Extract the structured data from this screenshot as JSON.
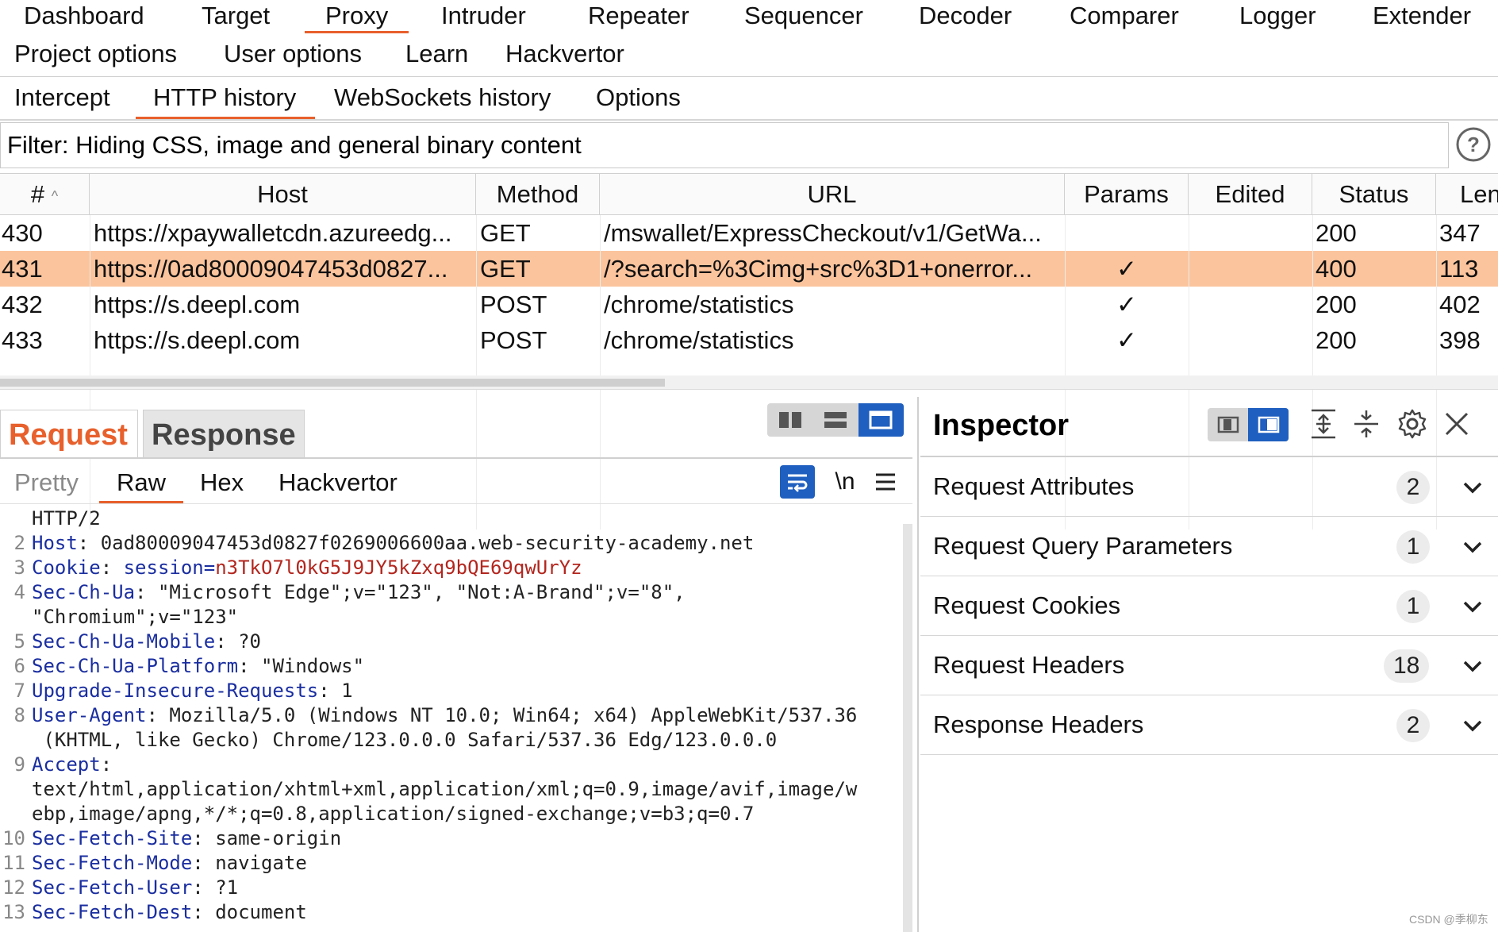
{
  "menu": {
    "row1": [
      "Dashboard",
      "Target",
      "Proxy",
      "Intruder",
      "Repeater",
      "Sequencer",
      "Decoder",
      "Comparer",
      "Logger",
      "Extender"
    ],
    "row2": [
      "Project options",
      "User options",
      "Learn",
      "Hackvertor"
    ],
    "active": "Proxy"
  },
  "subtabs": {
    "items": [
      "Intercept",
      "HTTP history",
      "WebSockets history",
      "Options"
    ],
    "active": "HTTP history"
  },
  "filter": {
    "text": "Filter: Hiding CSS, image and general binary content"
  },
  "table": {
    "columns": [
      "#",
      "Host",
      "Method",
      "URL",
      "Params",
      "Edited",
      "Status",
      "Len"
    ],
    "sort_indicator": "^",
    "rows": [
      {
        "num": "430",
        "host": "https://xpaywalletcdn.azureedg...",
        "method": "GET",
        "url": "/mswallet/ExpressCheckout/v1/GetWa...",
        "params": "",
        "edited": "",
        "status": "200",
        "len": "347",
        "selected": false
      },
      {
        "num": "431",
        "host": "https://0ad80009047453d0827...",
        "method": "GET",
        "url": "/?search=%3Cimg+src%3D1+onerror...",
        "params": "✓",
        "edited": "",
        "status": "400",
        "len": "113",
        "selected": true
      },
      {
        "num": "432",
        "host": "https://s.deepl.com",
        "method": "POST",
        "url": "/chrome/statistics",
        "params": "✓",
        "edited": "",
        "status": "200",
        "len": "402",
        "selected": false
      },
      {
        "num": "433",
        "host": "https://s.deepl.com",
        "method": "POST",
        "url": "/chrome/statistics",
        "params": "✓",
        "edited": "",
        "status": "200",
        "len": "398",
        "selected": false
      }
    ]
  },
  "message_tabs": {
    "request": "Request",
    "response": "Response",
    "active": "Request"
  },
  "view_tabs": {
    "items": [
      "Pretty",
      "Raw",
      "Hex",
      "Hackvertor"
    ],
    "active": "Raw"
  },
  "editor": {
    "newline_toggle": "\\n",
    "lines": [
      {
        "n": "",
        "key": "",
        "sep": "",
        "val": "HTTP/2"
      },
      {
        "n": "2",
        "key": "Host",
        "sep": ": ",
        "val": "0ad80009047453d0827f0269006600aa.web-security-academy.net"
      },
      {
        "n": "3",
        "key": "Cookie",
        "sep": ": ",
        "ckey": "session=",
        "cval": "n3TkO7l0kG5J9JY5kZxq9bQE69qwUrYz"
      },
      {
        "n": "4",
        "key": "Sec-Ch-Ua",
        "sep": ": ",
        "val": "\"Microsoft Edge\";v=\"123\", \"Not:A-Brand\";v=\"8\","
      },
      {
        "n": "",
        "key": "",
        "sep": "",
        "val": "\"Chromium\";v=\"123\""
      },
      {
        "n": "5",
        "key": "Sec-Ch-Ua-Mobile",
        "sep": ": ",
        "val": "?0"
      },
      {
        "n": "6",
        "key": "Sec-Ch-Ua-Platform",
        "sep": ": ",
        "val": "\"Windows\""
      },
      {
        "n": "7",
        "key": "Upgrade-Insecure-Requests",
        "sep": ": ",
        "val": "1"
      },
      {
        "n": "8",
        "key": "User-Agent",
        "sep": ": ",
        "val": "Mozilla/5.0 (Windows NT 10.0; Win64; x64) AppleWebKit/537.36"
      },
      {
        "n": "",
        "key": "",
        "sep": "",
        "val": " (KHTML, like Gecko) Chrome/123.0.0.0 Safari/537.36 Edg/123.0.0.0"
      },
      {
        "n": "9",
        "key": "Accept",
        "sep": ":",
        "val": ""
      },
      {
        "n": "",
        "key": "",
        "sep": "",
        "val": "text/html,application/xhtml+xml,application/xml;q=0.9,image/avif,image/w"
      },
      {
        "n": "",
        "key": "",
        "sep": "",
        "val": "ebp,image/apng,*/*;q=0.8,application/signed-exchange;v=b3;q=0.7"
      },
      {
        "n": "10",
        "key": "Sec-Fetch-Site",
        "sep": ": ",
        "val": "same-origin"
      },
      {
        "n": "11",
        "key": "Sec-Fetch-Mode",
        "sep": ": ",
        "val": "navigate"
      },
      {
        "n": "12",
        "key": "Sec-Fetch-User",
        "sep": ": ",
        "val": "?1"
      },
      {
        "n": "13",
        "key": "Sec-Fetch-Dest",
        "sep": ": ",
        "val": "document"
      }
    ]
  },
  "inspector": {
    "title": "Inspector",
    "sections": [
      {
        "label": "Request Attributes",
        "count": "2"
      },
      {
        "label": "Request Query Parameters",
        "count": "1"
      },
      {
        "label": "Request Cookies",
        "count": "1"
      },
      {
        "label": "Request Headers",
        "count": "18"
      },
      {
        "label": "Response Headers",
        "count": "2"
      }
    ]
  },
  "watermark": "CSDN @季柳东",
  "colors": {
    "accent": "#e8602c",
    "selected_row": "#fbc49d",
    "button_blue": "#1f5fbf",
    "header_key": "#1a2ea0",
    "cookie_value": "#b3261e"
  }
}
